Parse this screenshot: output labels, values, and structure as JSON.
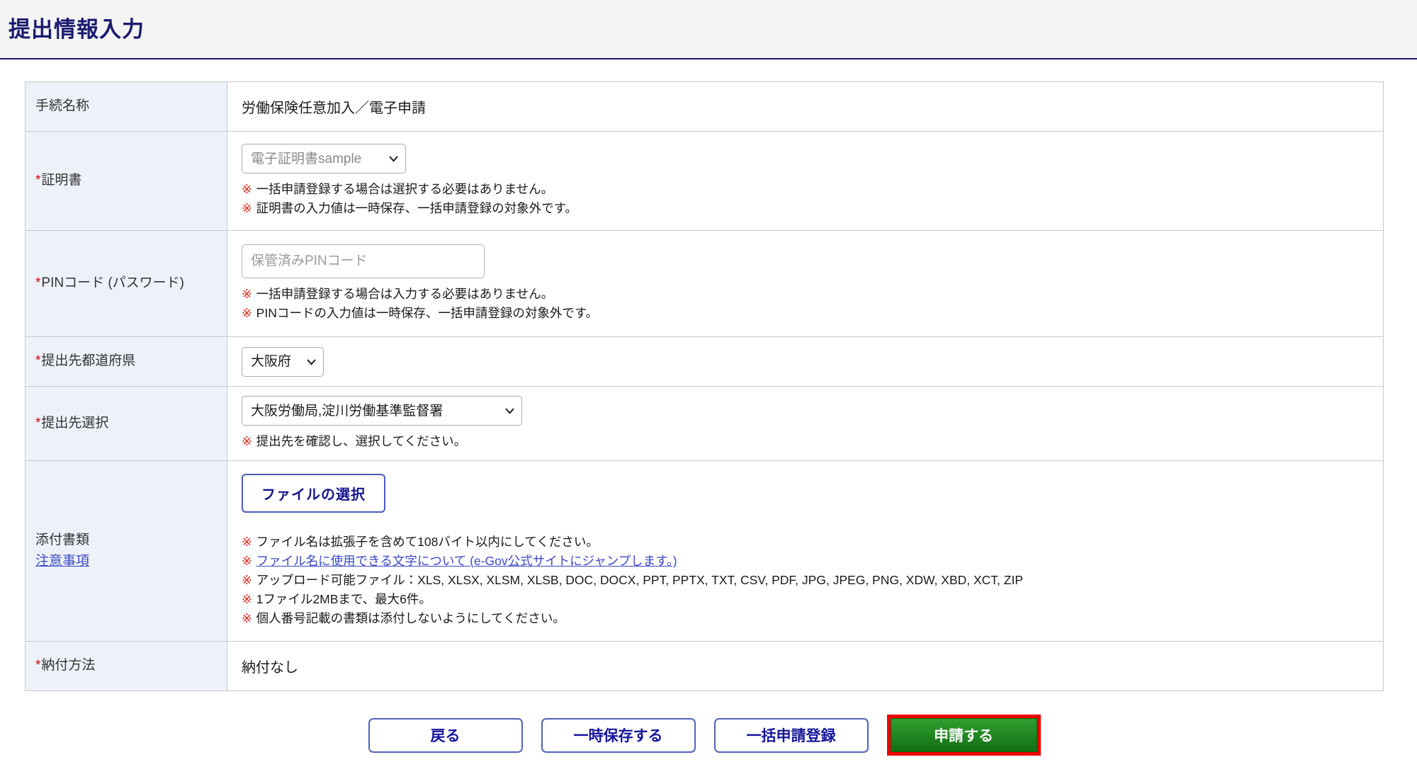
{
  "marks": {
    "required": "*",
    "note": "※"
  },
  "page": {
    "title": "提出情報入力"
  },
  "form": {
    "procedure": {
      "label": "手続名称",
      "value": "労働保険任意加入／電子申請"
    },
    "certificate": {
      "label": "証明書",
      "selected": "電子証明書sample",
      "notes": [
        "一括申請登録する場合は選択する必要はありません。",
        "証明書の入力値は一時保存、一括申請登録の対象外です。"
      ]
    },
    "pin": {
      "label": "PINコード (パスワード)",
      "placeholder": "保管済みPINコード",
      "value": "",
      "notes": [
        "一括申請登録する場合は入力する必要はありません。",
        "PINコードの入力値は一時保存、一括申請登録の対象外です。"
      ]
    },
    "prefecture": {
      "label": "提出先都道府県",
      "selected": "大阪府"
    },
    "destination": {
      "label": "提出先選択",
      "selected": "大阪労働局,淀川労働基準監督署",
      "note": "提出先を確認し、選択してください。"
    },
    "attachments": {
      "label": "添付書類",
      "caution_link": "注意事項",
      "file_button": "ファイルの選択",
      "note_filename": "ファイル名は拡張子を含めて108バイト以内にしてください。",
      "note_link": "ファイル名に使用できる文字について (e-Gov公式サイトにジャンプします。)",
      "note_filetypes": "アップロード可能ファイル：XLS, XLSX, XLSM, XLSB, DOC, DOCX, PPT, PPTX, TXT, CSV, PDF, JPG, JPEG, PNG, XDW, XBD, XCT, ZIP",
      "note_size": "1ファイル2MBまで、最大6件。",
      "note_mynumber": "個人番号記載の書類は添付しないようにしてください。"
    },
    "payment": {
      "label": "納付方法",
      "value": "納付なし"
    }
  },
  "actions": {
    "back": "戻る",
    "temp_save": "一時保存する",
    "batch_register": "一括申請登録",
    "submit": "申請する"
  },
  "colors": {
    "accent_navy": "#1b1b6f",
    "label_bg": "#edf2fa",
    "required_red": "#dd0000",
    "note_red": "#e02b20",
    "link_blue": "#3b49c4",
    "submit_green": "#1e8a1e",
    "highlight_red": "#ee0000"
  }
}
